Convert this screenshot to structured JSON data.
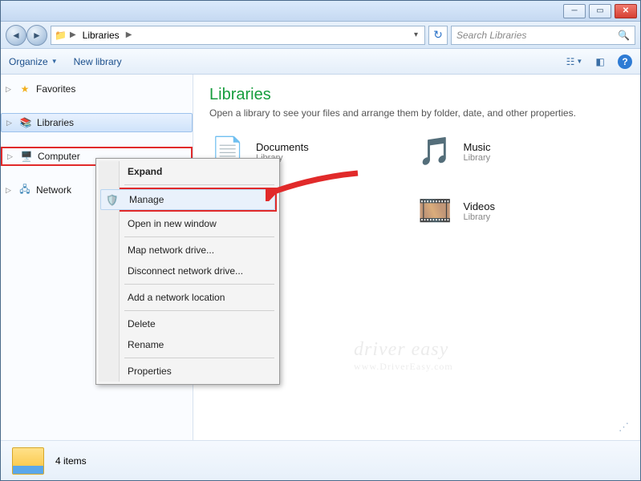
{
  "breadcrumb": {
    "root_icon": "folder",
    "item1": "Libraries"
  },
  "search": {
    "placeholder": "Search Libraries"
  },
  "cmdbar": {
    "organize": "Organize",
    "newlib": "New library"
  },
  "sidebar": {
    "favorites": "Favorites",
    "libraries": "Libraries",
    "computer": "Computer",
    "network": "Network"
  },
  "main": {
    "title": "Libraries",
    "subtitle": "Open a library to see your files and arrange them by folder, date, and other properties.",
    "items": [
      {
        "name": "Documents",
        "kind": "Library"
      },
      {
        "name": "Music",
        "kind": "Library"
      },
      {
        "name": "Videos",
        "kind": "Library"
      }
    ]
  },
  "context_menu": {
    "expand": "Expand",
    "manage": "Manage",
    "open_new_window": "Open in new window",
    "map_drive": "Map network drive...",
    "disconnect_drive": "Disconnect network drive...",
    "add_net_location": "Add a network location",
    "delete": "Delete",
    "rename": "Rename",
    "properties": "Properties"
  },
  "status": {
    "count_text": "4 items"
  },
  "watermark": {
    "line1": "driver easy",
    "line2": "www.DriverEasy.com"
  }
}
